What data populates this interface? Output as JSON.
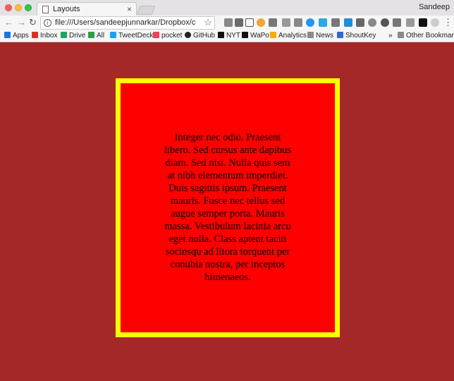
{
  "browser": {
    "tab_title": "Layouts",
    "tab_close": "×",
    "user_name": "Sandeep",
    "url": "file:///Users/sandeepjunnarkar/Dropbox/coding/te...",
    "info": "i",
    "star": "☆"
  },
  "bookmarks": [
    {
      "label": "Apps",
      "color": "#1a73e8"
    },
    {
      "label": "Inbox",
      "color": "#d93025"
    },
    {
      "label": "Drive",
      "color": "#1fa463"
    },
    {
      "label": "All",
      "color": "#2e9e44"
    },
    {
      "label": "TweetDeck",
      "color": "#1da1f2"
    },
    {
      "label": "pocket",
      "color": "#ef4056"
    },
    {
      "label": "GitHub",
      "color": "#222222"
    },
    {
      "label": "NYT",
      "color": "#111111"
    },
    {
      "label": "WaPo",
      "color": "#111111"
    },
    {
      "label": "Analytics",
      "color": "#f9ab00"
    },
    {
      "label": "News",
      "color": "#8a8a8a"
    },
    {
      "label": "ShoutKey",
      "color": "#3367d6"
    }
  ],
  "bookmarks_overflow": "»",
  "other_bookmarks": "Other Bookmarks",
  "page": {
    "paragraph": "Integer nec odio. Praesent libero. Sed cursus ante dapibus diam. Sed nisi. Nulla quis sem at nibh elementum imperdiet. Duis sagittis ipsum. Praesent mauris. Fusce nec tellus sed augue semper porta. Mauris massa. Vestibulum lacinia arcu eget nulla. Class aptent taciti sociosqu ad litora torquent per conubia nostra, per inceptos himenaeos.",
    "background_color": "#a52828",
    "box_color": "#ff0000",
    "box_border_color": "#ffff00"
  }
}
